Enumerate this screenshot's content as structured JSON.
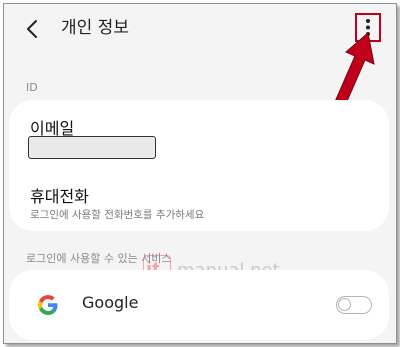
{
  "header": {
    "title": "개인 정보",
    "back_icon": "chevron-left-icon",
    "more_icon": "vertical-dots-icon"
  },
  "id_section": {
    "label": "ID",
    "email_label": "이메일",
    "email_value": "",
    "phone_label": "휴대전화",
    "phone_hint": "로그인에 사용할 전화번호를 추가하세요"
  },
  "services_section": {
    "label": "로그인에 사용할 수 있는 서비스",
    "google_label": "Google",
    "google_enabled": false,
    "google_icon": "google-g-icon"
  },
  "watermark": {
    "logo": "it",
    "text": "manual.net"
  },
  "colors": {
    "background": "#f4f4f4",
    "card": "#ffffff",
    "annotation_red": "#c0001a",
    "watermark_pink": "#f2a3a8"
  }
}
